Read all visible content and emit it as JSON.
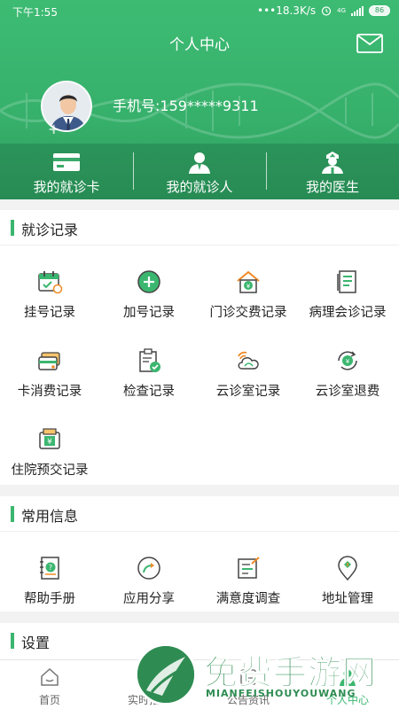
{
  "status_bar": {
    "time": "下午1:55",
    "speed": "•••18.3K/s",
    "network": "4G",
    "battery": "86"
  },
  "header": {
    "title": "个人中心",
    "phone": "手机号:159*****9311"
  },
  "quick_links": [
    {
      "label": "我的就诊卡",
      "icon": "card-icon"
    },
    {
      "label": "我的就诊人",
      "icon": "person-icon"
    },
    {
      "label": "我的医生",
      "icon": "doctor-icon"
    }
  ],
  "records": {
    "title": "就诊记录",
    "items": [
      {
        "label": "挂号记录",
        "icon": "calendar-icon"
      },
      {
        "label": "加号记录",
        "icon": "plus-circle-icon"
      },
      {
        "label": "门诊交费记录",
        "icon": "house-yuan-icon"
      },
      {
        "label": "病理会诊记录",
        "icon": "document-list-icon"
      },
      {
        "label": "卡消费记录",
        "icon": "cards-icon"
      },
      {
        "label": "检查记录",
        "icon": "clipboard-check-icon"
      },
      {
        "label": "云诊室记录",
        "icon": "cloud-icon"
      },
      {
        "label": "云诊室退费",
        "icon": "refund-icon"
      },
      {
        "label": "住院预交记录",
        "icon": "wallet-yuan-icon"
      }
    ]
  },
  "common": {
    "title": "常用信息",
    "items": [
      {
        "label": "帮助手册",
        "icon": "help-book-icon"
      },
      {
        "label": "应用分享",
        "icon": "share-icon"
      },
      {
        "label": "满意度调查",
        "icon": "survey-icon"
      },
      {
        "label": "地址管理",
        "icon": "location-icon"
      }
    ]
  },
  "settings": {
    "title": "设置"
  },
  "bottom_nav": [
    {
      "label": "首页",
      "icon": "home-icon"
    },
    {
      "label": "实时指南",
      "icon": "guide-icon"
    },
    {
      "label": "公告资讯",
      "icon": "news-icon"
    },
    {
      "label": "个人中心",
      "icon": "profile-icon"
    }
  ],
  "watermark": {
    "text": "免费手游网",
    "sub": "MIANFEISHOUYOUWANG"
  },
  "colors": {
    "primary": "#3bb66f",
    "primary_dark": "#2f9f60",
    "accent_orange": "#f08a24"
  }
}
